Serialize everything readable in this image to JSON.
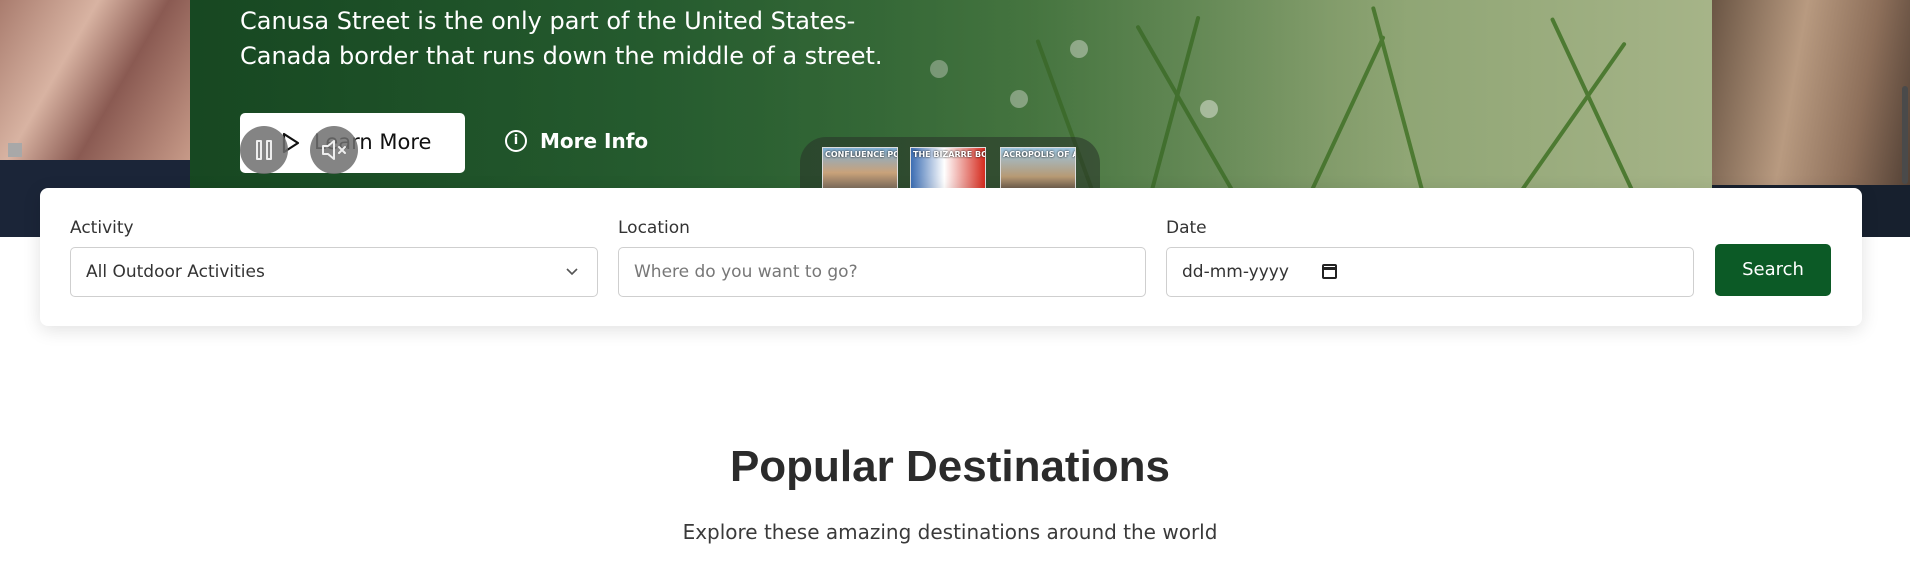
{
  "hero": {
    "description": "Canusa Street is the only part of the United States-Canada border that runs down the middle of a street.",
    "learn_more_label": "Learn More",
    "more_info_label": "More Info",
    "thumbnails": [
      {
        "caption": "CONFLUENCE POINT EARTH"
      },
      {
        "caption": "THE BIZARRE BORDER"
      },
      {
        "caption": "ACROPOLIS OF ATHENS"
      }
    ]
  },
  "search": {
    "activity_label": "Activity",
    "activity_value": "All Outdoor Activities",
    "location_label": "Location",
    "location_placeholder": "Where do you want to go?",
    "date_label": "Date",
    "date_placeholder": "dd-mm-yyyy",
    "button_label": "Search"
  },
  "section": {
    "title": "Popular Destinations",
    "subtitle": "Explore these amazing destinations around the world"
  },
  "colors": {
    "accent": "#0c5a26",
    "hero_green": "#2f6a3b"
  },
  "icons": [
    "play-icon",
    "pause-icon",
    "mute-icon",
    "info-icon",
    "chevron-down-icon",
    "calendar-icon"
  ]
}
